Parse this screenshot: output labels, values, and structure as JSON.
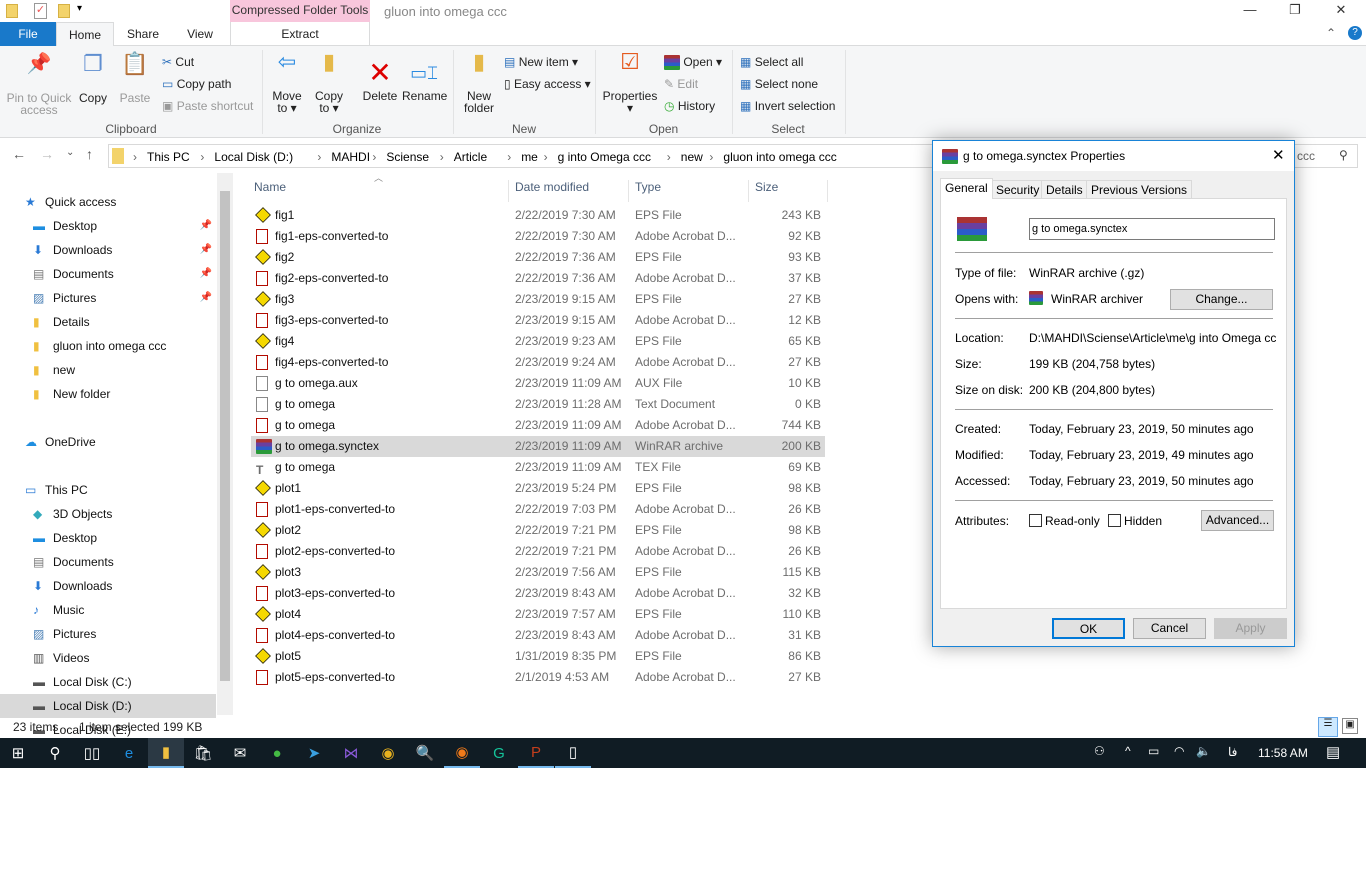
{
  "window": {
    "title": "gluon into omega ccc",
    "context_tab_group": "Compressed Folder Tools",
    "minimize": "—",
    "restore": "❐",
    "close": "✕"
  },
  "tabs": {
    "file": "File",
    "home": "Home",
    "share": "Share",
    "view": "View",
    "extract": "Extract"
  },
  "ribbon": {
    "clipboard": {
      "pin": "Pin to Quick access",
      "copy": "Copy",
      "paste": "Paste",
      "cut": "Cut",
      "copy_path": "Copy path",
      "paste_shortcut": "Paste shortcut",
      "label": "Clipboard"
    },
    "organize": {
      "move_to": "Move to ▾",
      "copy_to": "Copy to ▾",
      "delete": "Delete",
      "rename": "Rename",
      "label": "Organize"
    },
    "new": {
      "new_folder": "New folder",
      "new_item": "New item ▾",
      "easy_access": "Easy access ▾",
      "label": "New"
    },
    "open": {
      "properties": "Properties",
      "open": "Open ▾",
      "edit": "Edit",
      "history": "History",
      "label": "Open"
    },
    "select": {
      "select_all": "Select all",
      "select_none": "Select none",
      "invert": "Invert selection",
      "label": "Select"
    }
  },
  "address": {
    "crumbs": [
      "This PC",
      "Local Disk (D:)",
      "MAHDI",
      "Sciense",
      "Article",
      "me",
      "g into Omega ccc",
      "new",
      "gluon into omega ccc"
    ],
    "search_value": "ccc"
  },
  "sidebar": [
    {
      "label": "Quick access",
      "icon": "star",
      "pinned": false,
      "level": 0
    },
    {
      "label": "Desktop",
      "icon": "desktop",
      "pinned": true,
      "level": 1
    },
    {
      "label": "Downloads",
      "icon": "download",
      "pinned": true,
      "level": 1
    },
    {
      "label": "Documents",
      "icon": "document",
      "pinned": true,
      "level": 1
    },
    {
      "label": "Pictures",
      "icon": "picture",
      "pinned": true,
      "level": 1
    },
    {
      "label": "Details",
      "icon": "folder",
      "pinned": false,
      "level": 1
    },
    {
      "label": "gluon into omega ccc",
      "icon": "folder",
      "pinned": false,
      "level": 1
    },
    {
      "label": "new",
      "icon": "folder",
      "pinned": false,
      "level": 1
    },
    {
      "label": "New folder",
      "icon": "folder",
      "pinned": false,
      "level": 1
    },
    {
      "label": "",
      "icon": "",
      "level": -1
    },
    {
      "label": "OneDrive",
      "icon": "cloud",
      "pinned": false,
      "level": 0
    },
    {
      "label": "",
      "icon": "",
      "level": -1
    },
    {
      "label": "This PC",
      "icon": "pc",
      "pinned": false,
      "level": 0
    },
    {
      "label": "3D Objects",
      "icon": "cube",
      "level": 1
    },
    {
      "label": "Desktop",
      "icon": "desktop",
      "level": 1
    },
    {
      "label": "Documents",
      "icon": "document",
      "level": 1
    },
    {
      "label": "Downloads",
      "icon": "download",
      "level": 1
    },
    {
      "label": "Music",
      "icon": "music",
      "level": 1
    },
    {
      "label": "Pictures",
      "icon": "picture",
      "level": 1
    },
    {
      "label": "Videos",
      "icon": "video",
      "level": 1
    },
    {
      "label": "Local Disk (C:)",
      "icon": "drive",
      "level": 1
    },
    {
      "label": "Local Disk (D:)",
      "icon": "drive",
      "level": 1,
      "selected": true
    },
    {
      "label": "Local Disk (E:)",
      "icon": "drive",
      "level": 1
    }
  ],
  "columns": {
    "name": "Name",
    "date": "Date modified",
    "type": "Type",
    "size": "Size"
  },
  "files": [
    {
      "name": "fig1",
      "date": "2/22/2019 7:30 AM",
      "type": "EPS File",
      "size": "243 KB",
      "icon": "eps"
    },
    {
      "name": "fig1-eps-converted-to",
      "date": "2/22/2019 7:30 AM",
      "type": "Adobe Acrobat D...",
      "size": "92 KB",
      "icon": "pdf"
    },
    {
      "name": "fig2",
      "date": "2/22/2019 7:36 AM",
      "type": "EPS File",
      "size": "93 KB",
      "icon": "eps"
    },
    {
      "name": "fig2-eps-converted-to",
      "date": "2/22/2019 7:36 AM",
      "type": "Adobe Acrobat D...",
      "size": "37 KB",
      "icon": "pdf"
    },
    {
      "name": "fig3",
      "date": "2/23/2019 9:15 AM",
      "type": "EPS File",
      "size": "27 KB",
      "icon": "eps"
    },
    {
      "name": "fig3-eps-converted-to",
      "date": "2/23/2019 9:15 AM",
      "type": "Adobe Acrobat D...",
      "size": "12 KB",
      "icon": "pdf"
    },
    {
      "name": "fig4",
      "date": "2/23/2019 9:23 AM",
      "type": "EPS File",
      "size": "65 KB",
      "icon": "eps"
    },
    {
      "name": "fig4-eps-converted-to",
      "date": "2/23/2019 9:24 AM",
      "type": "Adobe Acrobat D...",
      "size": "27 KB",
      "icon": "pdf"
    },
    {
      "name": "g to omega.aux",
      "date": "2/23/2019 11:09 AM",
      "type": "AUX File",
      "size": "10 KB",
      "icon": "txt"
    },
    {
      "name": "g to omega",
      "date": "2/23/2019 11:28 AM",
      "type": "Text Document",
      "size": "0 KB",
      "icon": "txt"
    },
    {
      "name": "g to omega",
      "date": "2/23/2019 11:09 AM",
      "type": "Adobe Acrobat D...",
      "size": "744 KB",
      "icon": "pdf"
    },
    {
      "name": "g to omega.synctex",
      "date": "2/23/2019 11:09 AM",
      "type": "WinRAR archive",
      "size": "200 KB",
      "icon": "rar",
      "selected": true
    },
    {
      "name": "g to omega",
      "date": "2/23/2019 11:09 AM",
      "type": "TEX File",
      "size": "69 KB",
      "icon": "tex"
    },
    {
      "name": "plot1",
      "date": "2/23/2019 5:24 PM",
      "type": "EPS File",
      "size": "98 KB",
      "icon": "eps"
    },
    {
      "name": "plot1-eps-converted-to",
      "date": "2/22/2019 7:03 PM",
      "type": "Adobe Acrobat D...",
      "size": "26 KB",
      "icon": "pdf"
    },
    {
      "name": "plot2",
      "date": "2/22/2019 7:21 PM",
      "type": "EPS File",
      "size": "98 KB",
      "icon": "eps"
    },
    {
      "name": "plot2-eps-converted-to",
      "date": "2/22/2019 7:21 PM",
      "type": "Adobe Acrobat D...",
      "size": "26 KB",
      "icon": "pdf"
    },
    {
      "name": "plot3",
      "date": "2/23/2019 7:56 AM",
      "type": "EPS File",
      "size": "115 KB",
      "icon": "eps"
    },
    {
      "name": "plot3-eps-converted-to",
      "date": "2/23/2019 8:43 AM",
      "type": "Adobe Acrobat D...",
      "size": "32 KB",
      "icon": "pdf"
    },
    {
      "name": "plot4",
      "date": "2/23/2019 7:57 AM",
      "type": "EPS File",
      "size": "110 KB",
      "icon": "eps"
    },
    {
      "name": "plot4-eps-converted-to",
      "date": "2/23/2019 8:43 AM",
      "type": "Adobe Acrobat D...",
      "size": "31 KB",
      "icon": "pdf"
    },
    {
      "name": "plot5",
      "date": "1/31/2019 8:35 PM",
      "type": "EPS File",
      "size": "86 KB",
      "icon": "eps"
    },
    {
      "name": "plot5-eps-converted-to",
      "date": "2/1/2019 4:53 AM",
      "type": "Adobe Acrobat D...",
      "size": "27 KB",
      "icon": "pdf"
    }
  ],
  "status": {
    "count": "23 items",
    "selection": "1 item selected  199 KB"
  },
  "dialog": {
    "title": "g to omega.synctex Properties",
    "tabs": [
      "General",
      "Security",
      "Details",
      "Previous Versions"
    ],
    "filename": "g to omega.synctex",
    "type_label": "Type of file:",
    "type_value": "WinRAR archive (.gz)",
    "opens_label": "Opens with:",
    "opens_value": "WinRAR archiver",
    "change": "Change...",
    "location_label": "Location:",
    "location_value": "D:\\MAHDI\\Sciense\\Article\\me\\g into Omega ccc\\n",
    "size_label": "Size:",
    "size_value": "199 KB (204,758 bytes)",
    "disk_label": "Size on disk:",
    "disk_value": "200 KB (204,800 bytes)",
    "created_label": "Created:",
    "created_value": "Today, February 23, 2019, 50 minutes ago",
    "modified_label": "Modified:",
    "modified_value": "Today, February 23, 2019, 49 minutes ago",
    "accessed_label": "Accessed:",
    "accessed_value": "Today, February 23, 2019, 50 minutes ago",
    "attributes_label": "Attributes:",
    "readonly": "Read-only",
    "hidden": "Hidden",
    "advanced": "Advanced...",
    "ok": "OK",
    "cancel": "Cancel",
    "apply": "Apply",
    "close": "✕"
  },
  "taskbar": {
    "time": "11:58 AM",
    "lang": "فا",
    "apps": [
      "start",
      "search",
      "task-view",
      "edge",
      "file-explorer",
      "store",
      "mail",
      "app-green",
      "telegram",
      "visual-studio",
      "chrome",
      "search-app",
      "firefox",
      "grammarly",
      "powerpoint-p",
      "document"
    ]
  },
  "colors": {
    "accent": "#1979ca",
    "file_tab": "#1979ca",
    "context_tab": "#f8c6dc",
    "selection": "#d9d9d9",
    "taskbar": "#101c24"
  }
}
